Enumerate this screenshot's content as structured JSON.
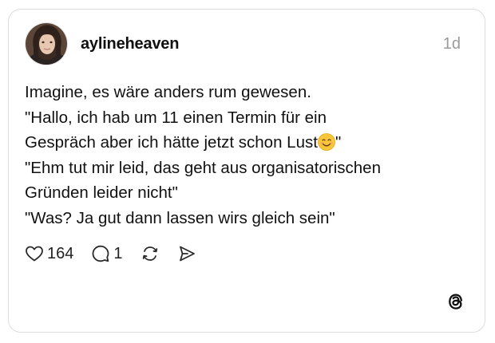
{
  "post": {
    "username": "aylineheaven",
    "time": "1d",
    "lines": [
      "Imagine, es wäre anders rum gewesen.",
      "\"Hallo, ich hab um 11 einen Termin für ein",
      "Gespräch aber ich hätte jetzt schon Lust",
      "\"",
      "\"Ehm tut mir leid, das geht aus organisatorischen",
      "Gründen leider nicht\"",
      "\"Was? Ja gut dann lassen wirs gleich sein\""
    ],
    "emoji": "smiling-face-emoji",
    "likes": "164",
    "replies": "1"
  },
  "icons": {
    "like": "heart-icon",
    "reply": "comment-icon",
    "repost": "repost-icon",
    "share": "send-icon",
    "brand": "threads-logo-icon"
  },
  "colors": {
    "text": "#101010",
    "muted": "#9a9a9a",
    "border": "#dcdcdc"
  }
}
